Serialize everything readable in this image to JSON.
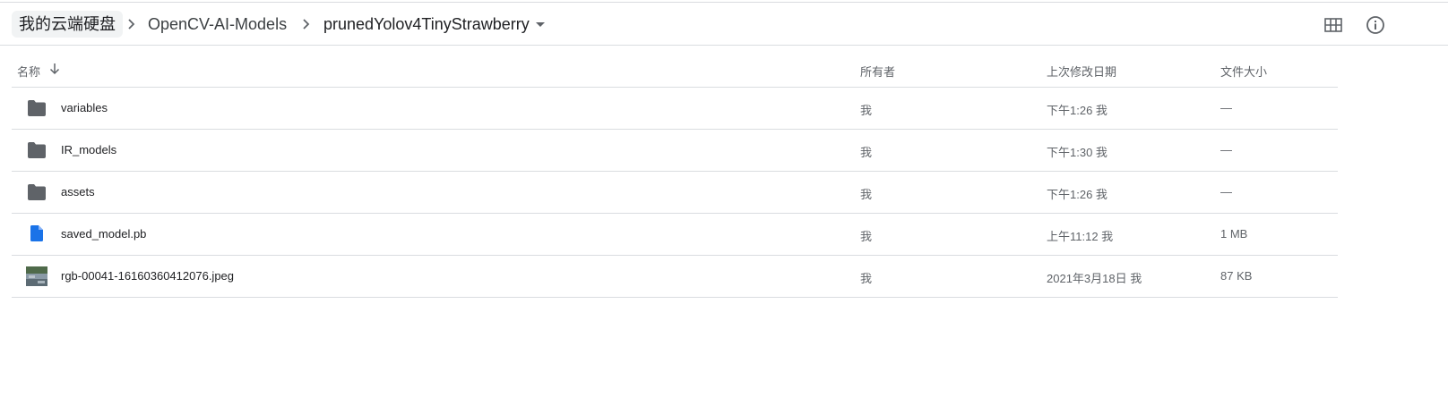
{
  "breadcrumb": {
    "root": "我的云端硬盘",
    "level2": "OpenCV-AI-Models",
    "current": "prunedYolov4TinyStrawberry"
  },
  "toolbar": {
    "grid_icon": "grid-view-icon",
    "info_icon": "info-icon"
  },
  "columns": {
    "name": "名称",
    "owner": "所有者",
    "modified": "上次修改日期",
    "size": "文件大小"
  },
  "files": [
    {
      "name": "variables",
      "type": "folder",
      "owner": "我",
      "modified": "下午1:26 我",
      "size": "—"
    },
    {
      "name": "IR_models",
      "type": "folder",
      "owner": "我",
      "modified": "下午1:30 我",
      "size": "—"
    },
    {
      "name": "assets",
      "type": "folder",
      "owner": "我",
      "modified": "下午1:26 我",
      "size": "—"
    },
    {
      "name": "saved_model.pb",
      "type": "file",
      "owner": "我",
      "modified": "上午11:12 我",
      "size": "1 MB"
    },
    {
      "name": "rgb-00041-16160360412076.jpeg",
      "type": "image",
      "owner": "我",
      "modified": "2021年3月18日 我",
      "size": "87 KB"
    }
  ],
  "colors": {
    "folder": "#5f6368",
    "file_blue": "#1a73e8",
    "divider": "#dadce0"
  }
}
